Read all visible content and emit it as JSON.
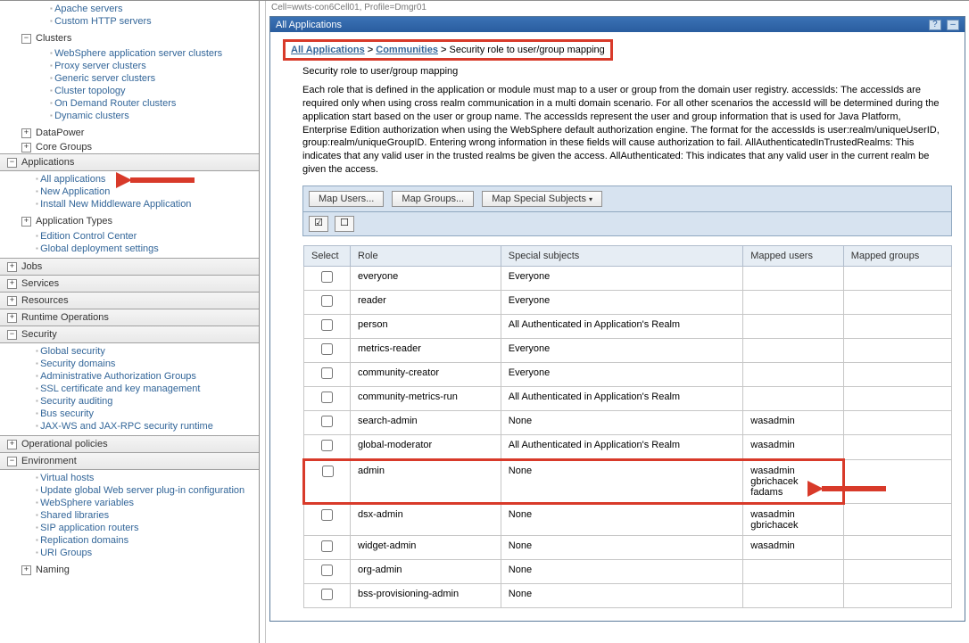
{
  "nav": {
    "apache": "Apache servers",
    "customhttp": "Custom HTTP servers",
    "clusters": "Clusters",
    "cluster_items": [
      "WebSphere application server clusters",
      "Proxy server clusters",
      "Generic server clusters",
      "Cluster topology",
      "On Demand Router clusters",
      "Dynamic clusters"
    ],
    "datapower": "DataPower",
    "coregroups": "Core Groups",
    "applications": "Applications",
    "apps_items": [
      "All applications",
      "New Application",
      "Install New Middleware Application"
    ],
    "apptypes": "Application Types",
    "apptypes_items": [
      "Edition Control Center",
      "Global deployment settings"
    ],
    "jobs": "Jobs",
    "services": "Services",
    "resources": "Resources",
    "runtimeops": "Runtime Operations",
    "security": "Security",
    "security_items": [
      "Global security",
      "Security domains",
      "Administrative Authorization Groups",
      "SSL certificate and key management",
      "Security auditing",
      "Bus security",
      "JAX-WS and JAX-RPC security runtime"
    ],
    "oppolicies": "Operational policies",
    "environment": "Environment",
    "env_items": [
      "Virtual hosts",
      "Update global Web server plug-in configuration",
      "WebSphere variables",
      "Shared libraries",
      "SIP application routers",
      "Replication domains",
      "URI Groups"
    ],
    "naming": "Naming"
  },
  "cellinfo": "Cell=wwts-con6Cell01, Profile=Dmgr01",
  "panel": {
    "title": "All Applications",
    "crumb1": "All Applications",
    "crumb2": "Communities",
    "crumb3": "Security role to user/group mapping",
    "sub": "Security role to user/group mapping",
    "help": "Each role that is defined in the application or module must map to a user or group from the domain user registry. accessIds: The accessIds are required only when using cross realm communication in a multi domain scenario. For all other scenarios the accessId will be determined during the application start based on the user or group name. The accessIds represent the user and group information that is used for Java Platform, Enterprise Edition authorization when using the WebSphere default authorization engine. The format for the accessIds is user:realm/uniqueUserID, group:realm/uniqueGroupID. Entering wrong information in these fields will cause authorization to fail. AllAuthenticatedInTrustedRealms: This indicates that any valid user in the trusted realms be given the access. AllAuthenticated: This indicates that any valid user in the current realm be given the access.",
    "btn_mapusers": "Map Users...",
    "btn_mapgroups": "Map Groups...",
    "btn_mapspecial": "Map Special Subjects"
  },
  "table": {
    "h_select": "Select",
    "h_role": "Role",
    "h_special": "Special subjects",
    "h_users": "Mapped users",
    "h_groups": "Mapped groups",
    "rows": [
      {
        "role": "everyone",
        "special": "Everyone",
        "users": "",
        "groups": ""
      },
      {
        "role": "reader",
        "special": "Everyone",
        "users": "",
        "groups": ""
      },
      {
        "role": "person",
        "special": "All Authenticated in Application's Realm",
        "users": "",
        "groups": ""
      },
      {
        "role": "metrics-reader",
        "special": "Everyone",
        "users": "",
        "groups": ""
      },
      {
        "role": "community-creator",
        "special": "Everyone",
        "users": "",
        "groups": ""
      },
      {
        "role": "community-metrics-run",
        "special": "All Authenticated in Application's Realm",
        "users": "",
        "groups": ""
      },
      {
        "role": "search-admin",
        "special": "None",
        "users": "wasadmin",
        "groups": ""
      },
      {
        "role": "global-moderator",
        "special": "All Authenticated in Application's Realm",
        "users": "wasadmin",
        "groups": ""
      },
      {
        "role": "admin",
        "special": "None",
        "users": "wasadmin\ngbrichacek\nfadams",
        "groups": ""
      },
      {
        "role": "dsx-admin",
        "special": "None",
        "users": "wasadmin\ngbrichacek",
        "groups": ""
      },
      {
        "role": "widget-admin",
        "special": "None",
        "users": "wasadmin",
        "groups": ""
      },
      {
        "role": "org-admin",
        "special": "None",
        "users": "",
        "groups": ""
      },
      {
        "role": "bss-provisioning-admin",
        "special": "None",
        "users": "",
        "groups": ""
      }
    ]
  }
}
